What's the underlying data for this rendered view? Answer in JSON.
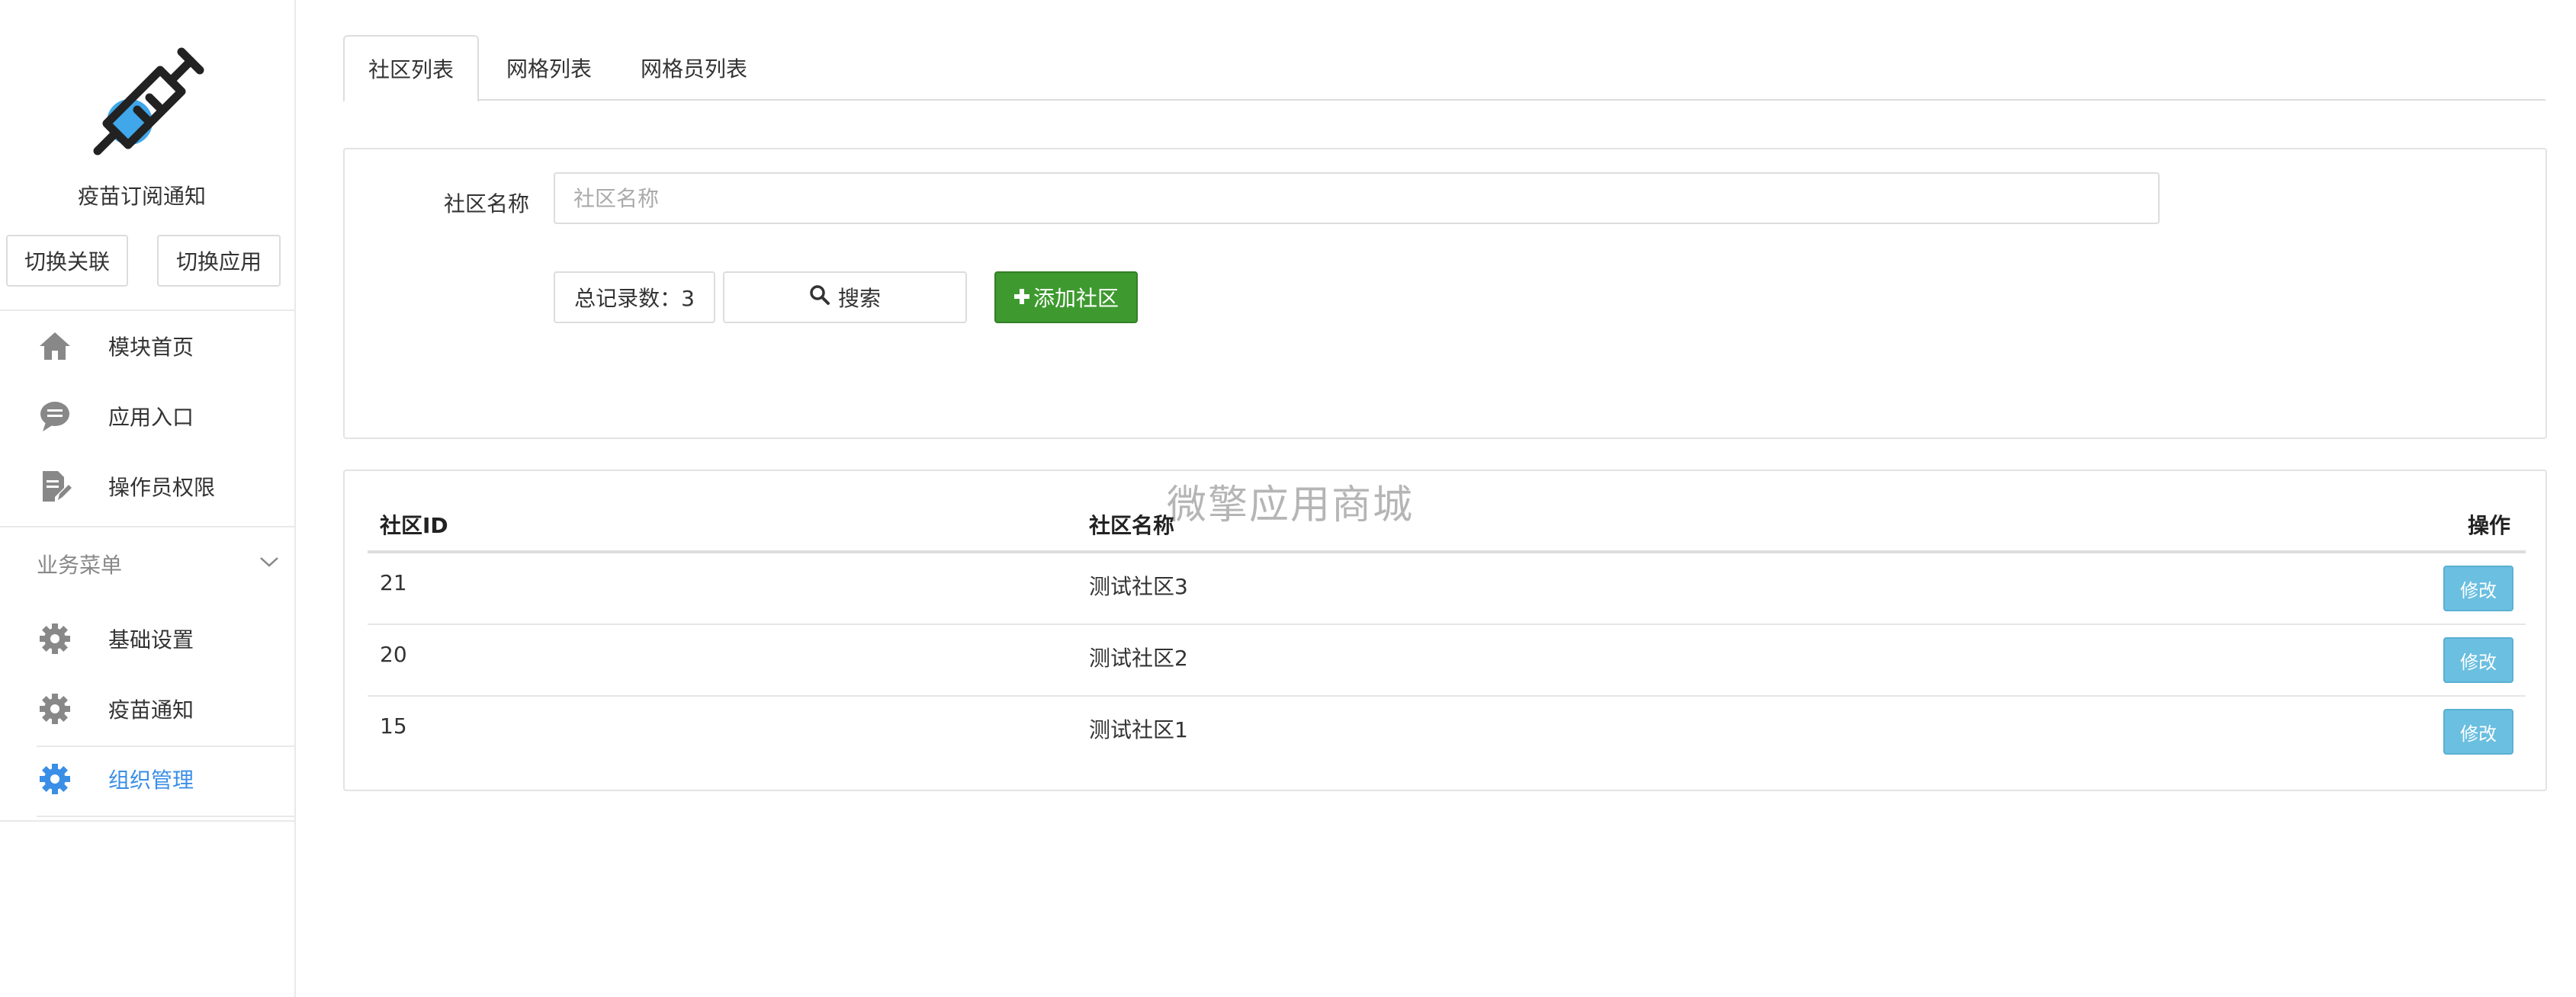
{
  "sidebar": {
    "app_name": "疫苗订阅通知",
    "switch_link_label": "切换关联",
    "switch_app_label": "切换应用",
    "nav_items": [
      {
        "label": "模块首页",
        "icon": "home-icon"
      },
      {
        "label": "应用入口",
        "icon": "chat-bubble-icon"
      },
      {
        "label": "操作员权限",
        "icon": "edit-document-icon"
      }
    ],
    "section_title": "业务菜单",
    "business_items": [
      {
        "label": "基础设置",
        "icon": "gear-icon"
      },
      {
        "label": "疫苗通知",
        "icon": "gear-icon"
      },
      {
        "label": "组织管理",
        "icon": "gear-icon",
        "active": true
      }
    ],
    "active_color": "#3a8ee6"
  },
  "tabs": [
    {
      "label": "社区列表",
      "active": true
    },
    {
      "label": "网格列表"
    },
    {
      "label": "网格员列表"
    }
  ],
  "search": {
    "label": "社区名称",
    "placeholder": "社区名称",
    "count_text": "总记录数：3",
    "search_label": "搜索",
    "add_label": "添加社区",
    "add_color": "#3e9a2f"
  },
  "table": {
    "headers": [
      "社区ID",
      "社区名称",
      "操作"
    ],
    "rows": [
      {
        "id": "21",
        "name": "测试社区3",
        "action": "修改"
      },
      {
        "id": "20",
        "name": "测试社区2",
        "action": "修改"
      },
      {
        "id": "15",
        "name": "测试社区1",
        "action": "修改"
      }
    ],
    "action_color": "#6bbfe0"
  },
  "watermark": "微擎应用商城"
}
